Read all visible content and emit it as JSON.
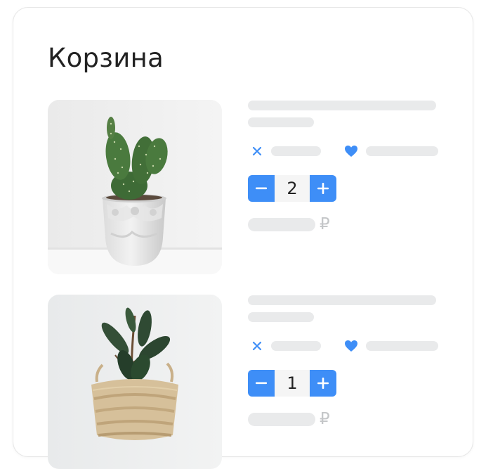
{
  "cart": {
    "title": "Корзина",
    "items": [
      {
        "image": "cactus-in-stone-pot",
        "quantity": "2",
        "currency_symbol": "₽"
      },
      {
        "image": "ficus-in-woven-basket",
        "quantity": "1",
        "currency_symbol": "₽"
      }
    ]
  },
  "icons": {
    "remove": "close-icon",
    "favorite": "heart-icon",
    "decrement": "minus-icon",
    "increment": "plus-icon"
  },
  "colors": {
    "accent": "#3e8ef7",
    "skeleton": "#e9eaeb",
    "text": "#222222",
    "muted": "#c4c6c8"
  }
}
